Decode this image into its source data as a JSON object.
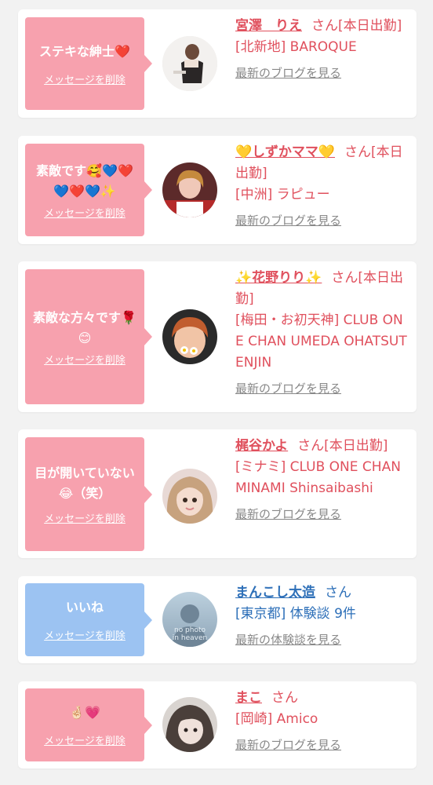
{
  "cards": [
    {
      "message": "ステキな紳士❤️",
      "delete_label": "メッセージを削除",
      "name": "宮澤　りえ",
      "san": "さん",
      "status": "[本日出勤]",
      "shop": "[北新地] BAROQUE",
      "link": "最新のブログを見る"
    },
    {
      "message_line1": "素敵です🥰💙❤️",
      "message_line2": "💙❤️💙✨",
      "delete_label": "メッセージを削除",
      "name": "💛しずかママ💛",
      "san": "さん",
      "status": "[本日出勤]",
      "shop": "[中洲] ラピュー",
      "link": "最新のブログを見る"
    },
    {
      "message_line1": "素敵な方々です🌹",
      "message_line2": "😊",
      "delete_label": "メッセージを削除",
      "name": "✨花野りり✨",
      "san": "さん",
      "status": "[本日出勤]",
      "shop": "[梅田・お初天神] CLUB ONE CHAN UMEDA OHATSUTENJIN",
      "link": "最新のブログを見る"
    },
    {
      "message_line1": "目が開いていない",
      "message_line2": "😂（笑）",
      "delete_label": "メッセージを削除",
      "name": "梶谷かよ",
      "san": "さん",
      "status": "[本日出勤]",
      "shop": "[ミナミ] CLUB ONE CHAN MINAMI Shinsaibashi",
      "link": "最新のブログを見る"
    },
    {
      "message": "いいね",
      "delete_label": "メッセージを削除",
      "name": "まんこし太造",
      "san": "さん",
      "shop": "[東京都] 体験談 9件",
      "link": "最新の体験談を見る",
      "avatar_text_line1": "no photo",
      "avatar_text_line2": "in heaven"
    },
    {
      "message": "🤞🏻💗",
      "delete_label": "メッセージを削除",
      "name": "まこ",
      "san": "さん",
      "shop": "[岡崎] Amico",
      "link": "最新のブログを見る"
    }
  ],
  "colors": {
    "pink_bubble": "#f7a1ae",
    "blue_bubble": "#9cc3f2",
    "name_red": "#e0505d",
    "name_blue": "#2d6fb8"
  }
}
